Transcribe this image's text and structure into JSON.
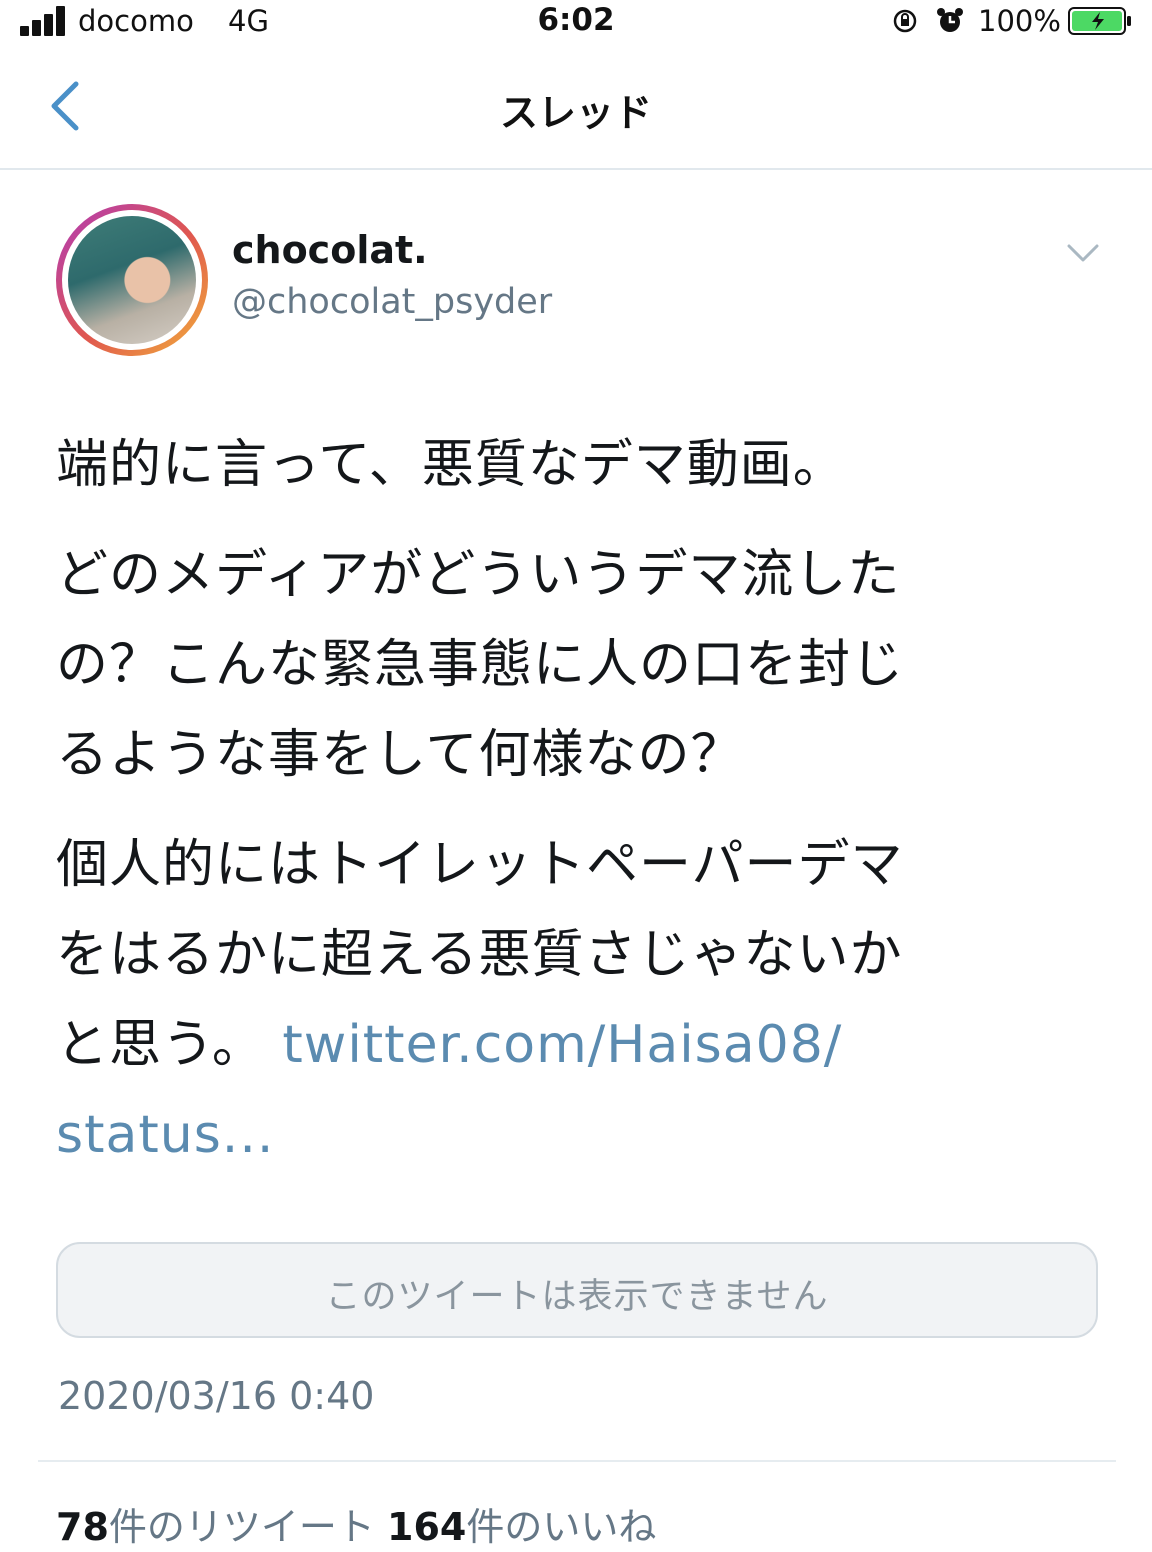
{
  "status_bar": {
    "carrier": "docomo",
    "network": "4G",
    "time": "6:02",
    "battery_percent": "100%",
    "icons": [
      "signal-icon",
      "rotation-lock-icon",
      "alarm-icon",
      "battery-charging-icon"
    ]
  },
  "nav": {
    "title": "スレッド",
    "back_icon": "chevron-left-icon"
  },
  "tweet": {
    "display_name": "chocolat.",
    "handle": "@chocolat_psyder",
    "menu_icon": "chevron-down-icon",
    "lines": [
      "端的に言って、悪質なデマ動画。",
      "どのメディアがどういうデマ流した",
      "の？こんな緊急事態に人の口を封じ",
      "るような事をして何様なの？",
      "個人的にはトイレットペーパーデマ",
      "をはるかに超える悪質さじゃないか",
      "と思う。"
    ],
    "link_part1": "twitter.com/Haisa08/",
    "link_part2": "status...",
    "unavailable_text": "このツイートは表示できません",
    "timestamp": "2020/03/16 0:40",
    "retweet_count": "78",
    "retweet_label": "件のリツイート",
    "like_count": "164",
    "like_label": "件のいいね"
  },
  "colors": {
    "link": "#5b8bb0",
    "secondary_text": "#657786",
    "primary_text": "#14171a",
    "battery_green": "#4cd964"
  }
}
